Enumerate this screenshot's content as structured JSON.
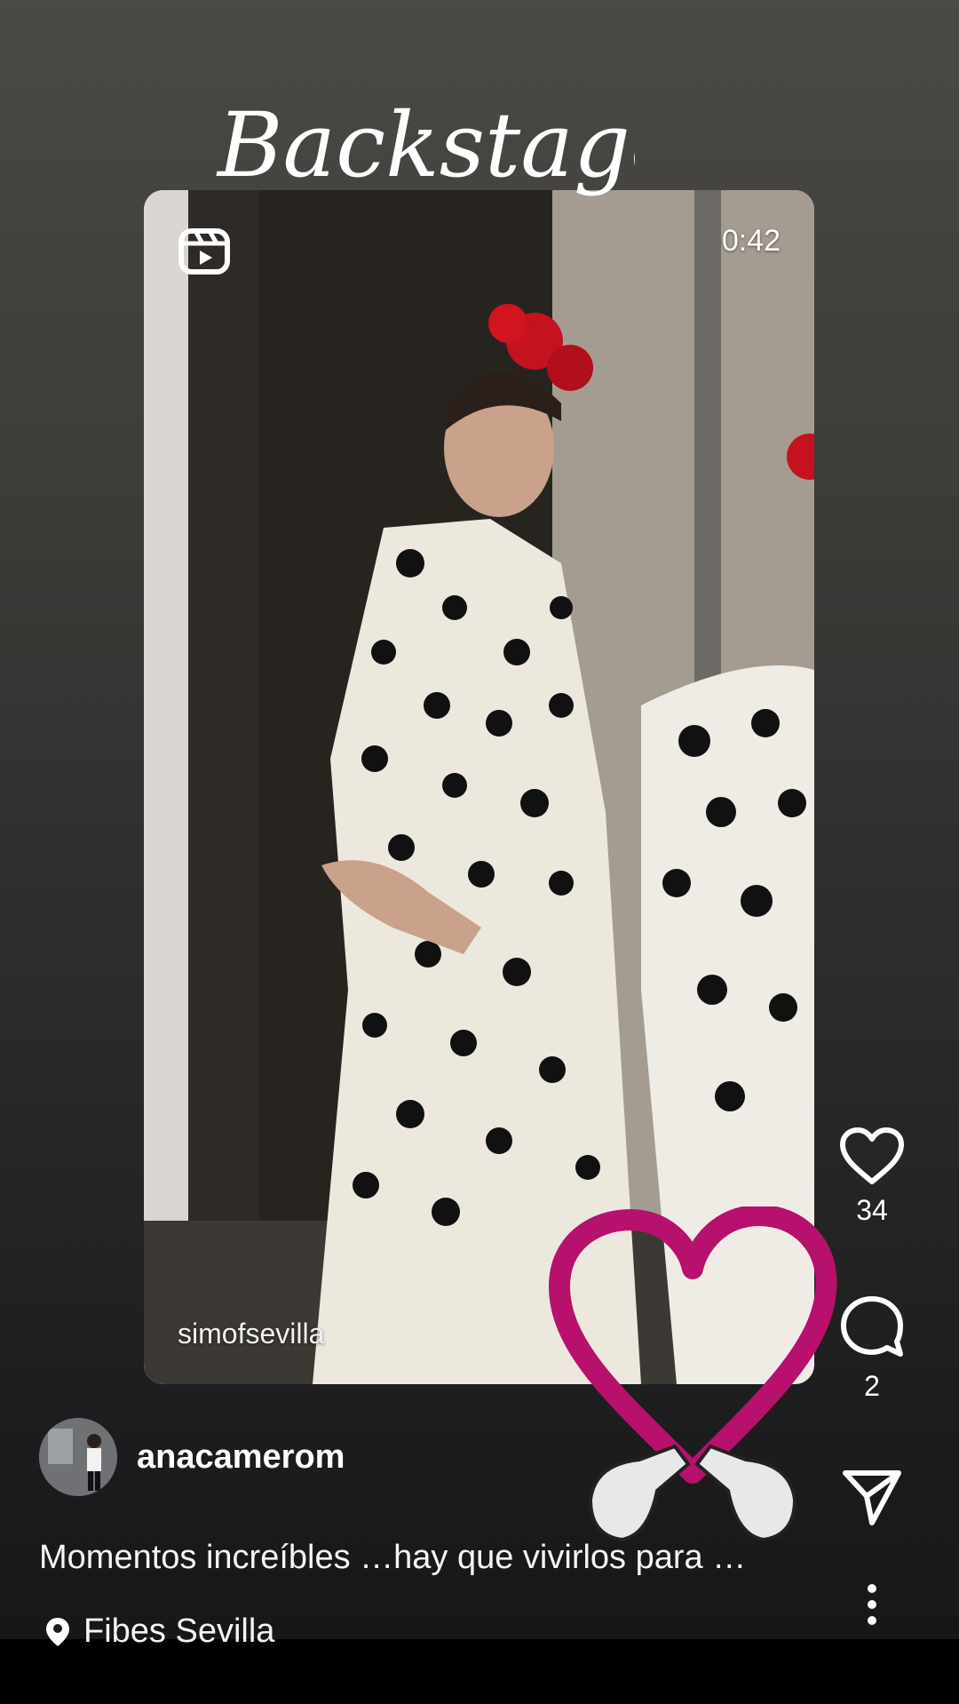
{
  "sticker": {
    "title_text": "Backstage"
  },
  "video": {
    "duration": "0:42",
    "watermark": "simofsevilla",
    "reel_icon": "reels-icon"
  },
  "actions": {
    "like_count": "34",
    "comment_count": "2",
    "icons": [
      "heart-icon",
      "comment-icon",
      "share-icon",
      "more-icon"
    ]
  },
  "post": {
    "username": "anacamerom",
    "caption": "Momentos increíbles …hay que vivirlos para …",
    "location": "Fibes Sevilla"
  }
}
